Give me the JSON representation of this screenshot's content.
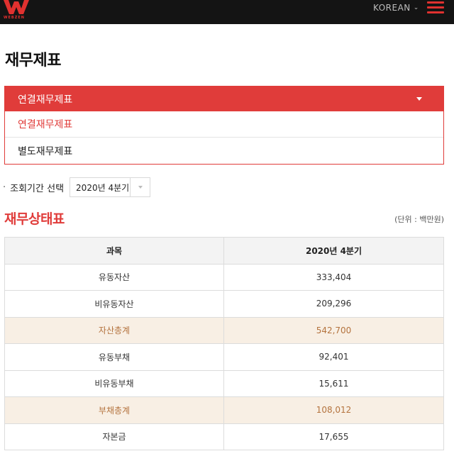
{
  "brand": {
    "name": "WEBZEN",
    "accent": "#e03c3a"
  },
  "header": {
    "language": "KOREAN",
    "menu_icon": "hamburger-icon"
  },
  "page_title": "재무제표",
  "statement_dropdown": {
    "selected": "연결재무제표",
    "options": [
      "연결재무제표",
      "별도재무제표"
    ]
  },
  "period": {
    "label": "조회기간 선택",
    "selected": "2020년 4분기"
  },
  "balance_sheet": {
    "title": "재무상태표",
    "unit": "(단위 : 백만원)",
    "columns": [
      "과목",
      "2020년 4분기"
    ],
    "rows": [
      {
        "item": "유동자산",
        "value": "333,404",
        "total": false
      },
      {
        "item": "비유동자산",
        "value": "209,296",
        "total": false
      },
      {
        "item": "자산총계",
        "value": "542,700",
        "total": true
      },
      {
        "item": "유동부채",
        "value": "92,401",
        "total": false
      },
      {
        "item": "비유동부채",
        "value": "15,611",
        "total": false
      },
      {
        "item": "부채총계",
        "value": "108,012",
        "total": true
      },
      {
        "item": "자본금",
        "value": "17,655",
        "total": false
      }
    ]
  }
}
